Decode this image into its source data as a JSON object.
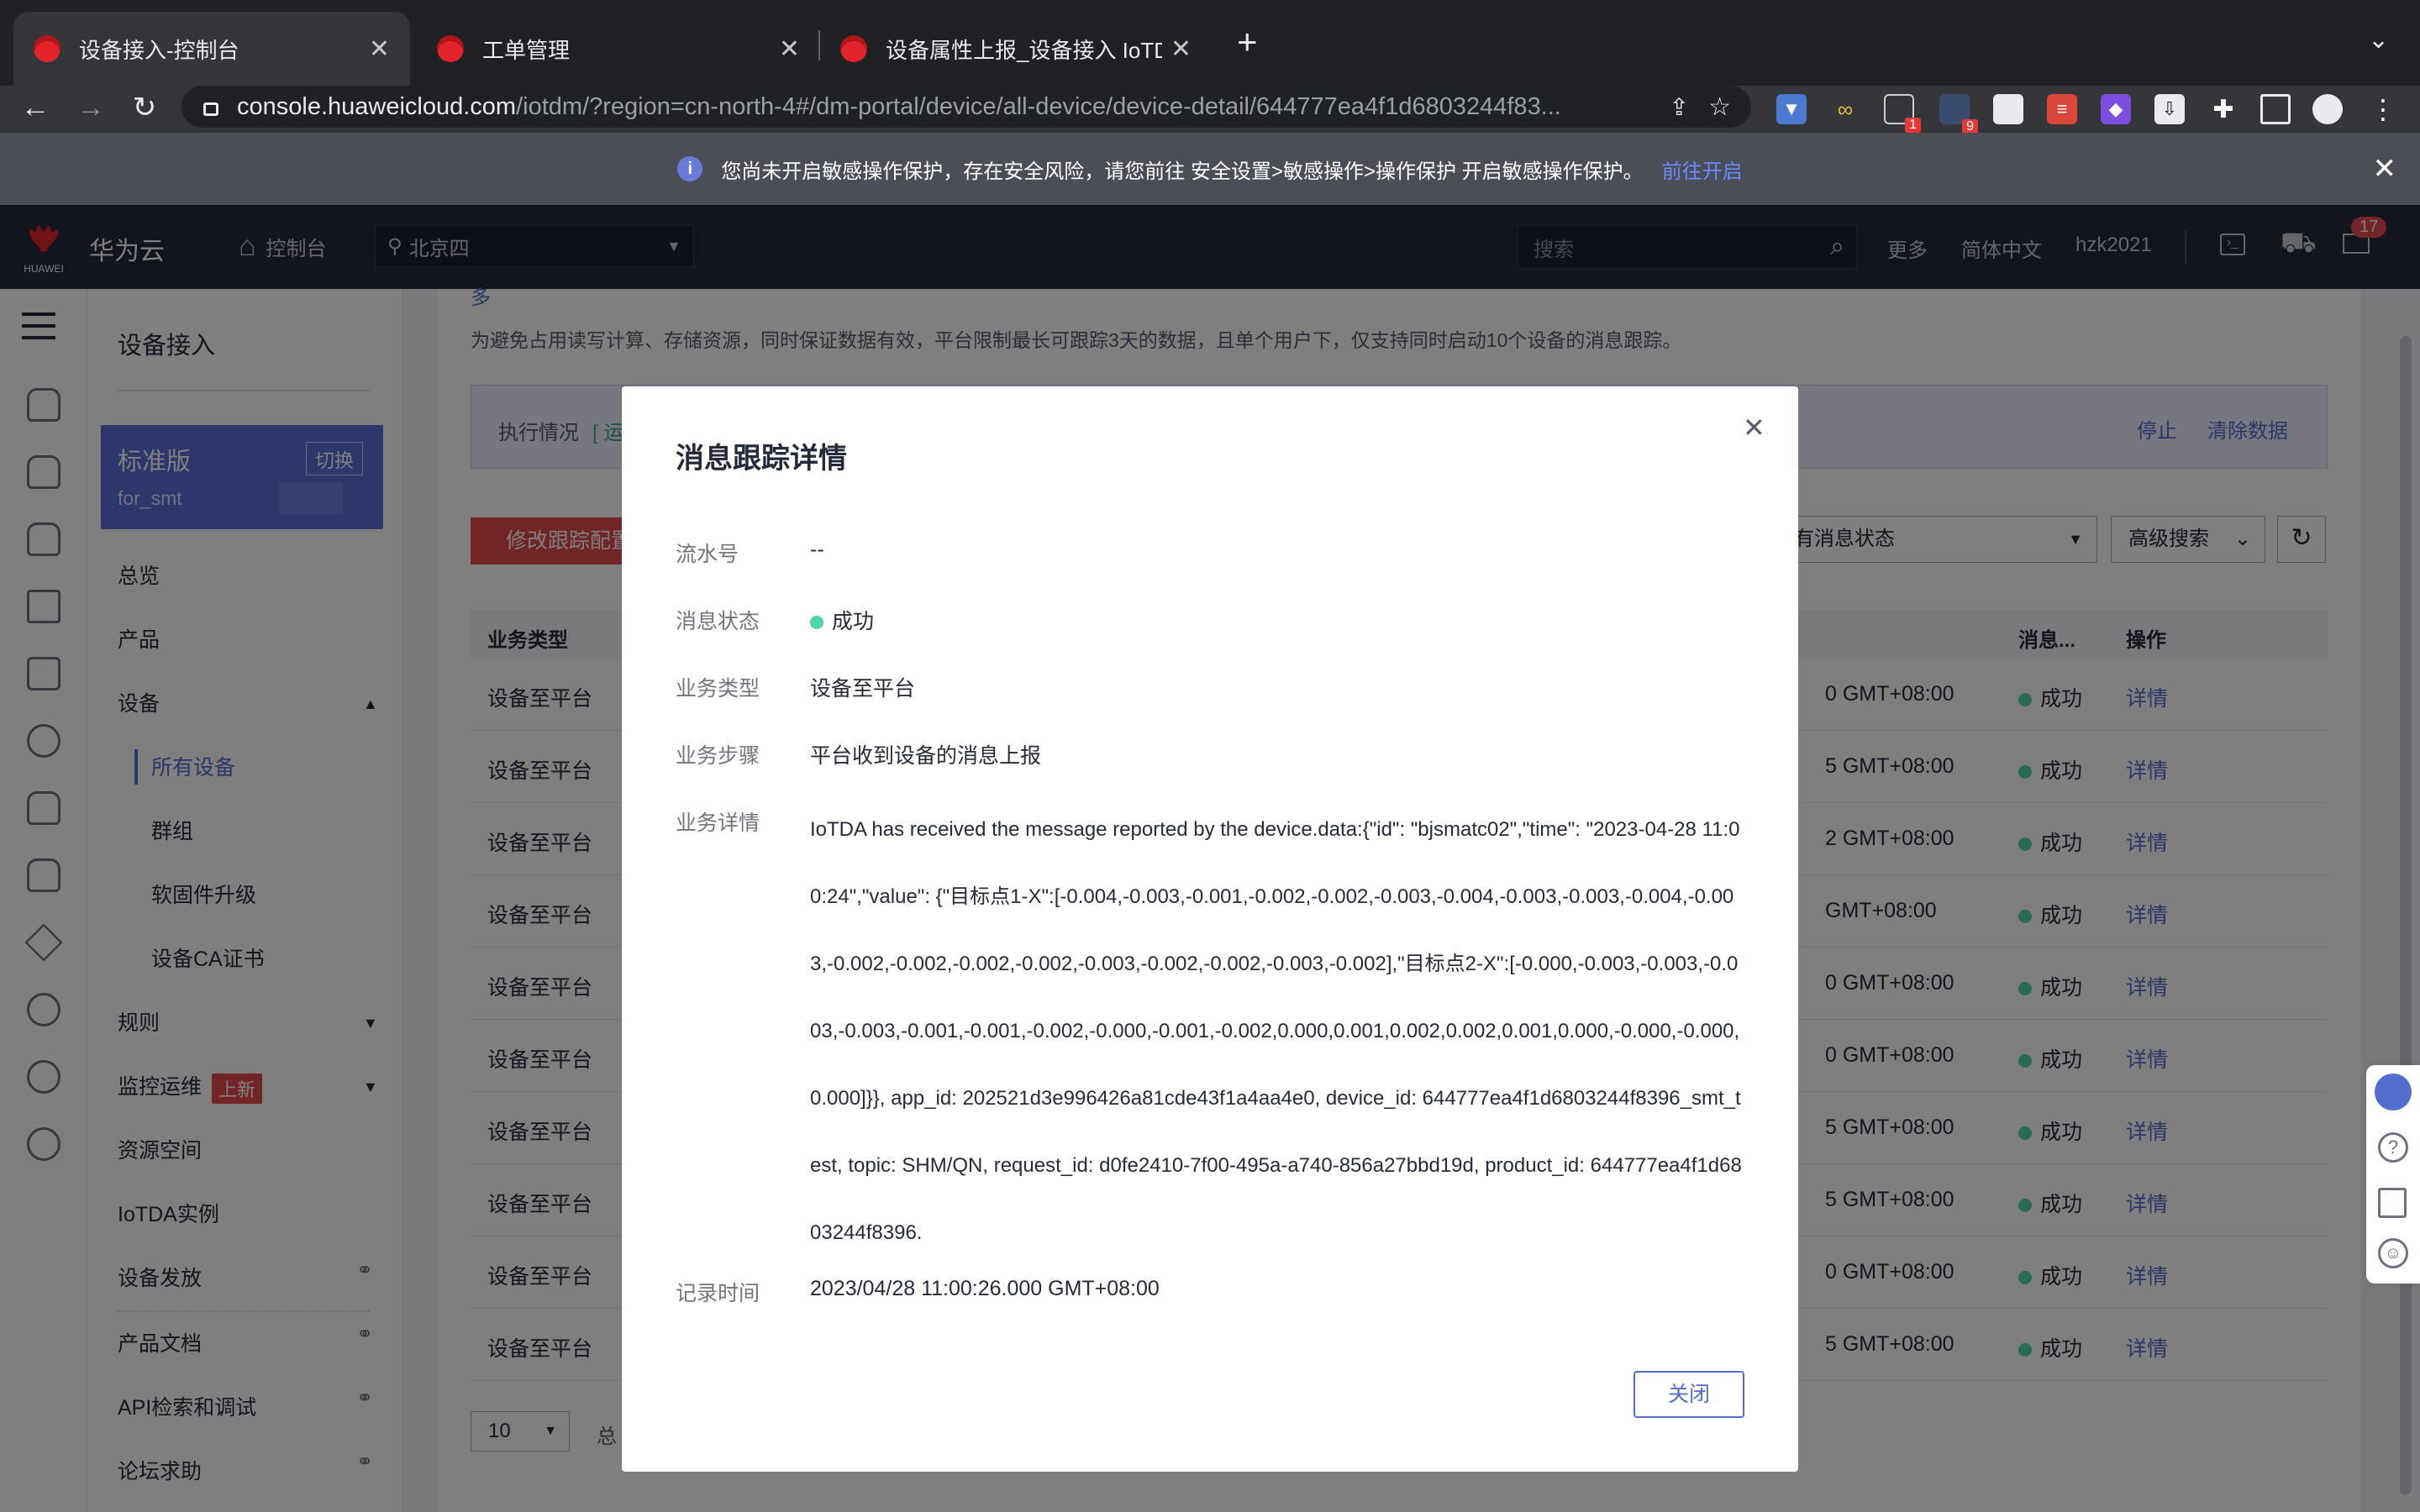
{
  "browser": {
    "tabs": [
      {
        "title": "设备接入-控制台",
        "active": true
      },
      {
        "title": "工单管理",
        "active": false
      },
      {
        "title": "设备属性上报_设备接入 IoTDA_",
        "active": false
      }
    ],
    "new_tab_icon": "plus-icon",
    "url_host": "console.huaweicloud.com",
    "url_path": "/iotdm/?region=cn-north-4#/dm-portal/device/all-device/device-detail/644777ea4f1d6803244f83...",
    "ext_badges": [
      "1",
      "9"
    ]
  },
  "banner": {
    "text": "您尚未开启敏感操作保护，存在安全风险，请您前往 安全设置>敏感操作>操作保护 开启敏感操作保护。",
    "link": "前往开启",
    "accent": "#526ecc"
  },
  "header": {
    "logo_text": "HUAWEI",
    "brand": "华为云",
    "console": "控制台",
    "region": "北京四",
    "search_placeholder": "搜索",
    "more": "更多",
    "language": "简体中文",
    "user": "hzk2021",
    "mail_badge": "17"
  },
  "sidebar": {
    "title": "设备接入",
    "edition": "标准版",
    "switch_label": "切换",
    "instance": "for_smt",
    "items": {
      "overview": "总览",
      "products": "产品",
      "devices": "设备",
      "all_devices": "所有设备",
      "groups": "群组",
      "firmware": "软固件升级",
      "ca": "设备CA证书",
      "rules": "规则",
      "monitor": "监控运维",
      "monitor_badge": "上新",
      "resource_space": "资源空间",
      "instances": "IoTDA实例",
      "provisioning": "设备发放",
      "docs": "产品文档",
      "api": "API检索和调试",
      "forum": "论坛求助"
    }
  },
  "main": {
    "top_fragment": "多",
    "notice": "为避免占用读写计算、存储资源，同时保证数据有效，平台限制最长可跟踪3天的数据，且单个用户下，仅支持同时启动10个设备的消息跟踪。",
    "exec_label": "执行情况",
    "exec_status": "[ 运",
    "stop": "停止",
    "clear": "清除数据",
    "modify_button": "修改跟踪配置",
    "status_filter": "有消息状态",
    "advanced_search": "高级搜索",
    "table": {
      "headers": {
        "type": "业务类型",
        "status": "消息...",
        "action": "操作"
      },
      "rows": [
        {
          "type": "设备至平台",
          "time_suffix": "0 GMT+08:00",
          "status": "成功",
          "action": "详情"
        },
        {
          "type": "设备至平台",
          "time_suffix": "5 GMT+08:00",
          "status": "成功",
          "action": "详情"
        },
        {
          "type": "设备至平台",
          "time_suffix": "2 GMT+08:00",
          "status": "成功",
          "action": "详情"
        },
        {
          "type": "设备至平台",
          "time_suffix": "GMT+08:00",
          "status": "成功",
          "action": "详情"
        },
        {
          "type": "设备至平台",
          "time_suffix": "0 GMT+08:00",
          "status": "成功",
          "action": "详情"
        },
        {
          "type": "设备至平台",
          "time_suffix": "0 GMT+08:00",
          "status": "成功",
          "action": "详情"
        },
        {
          "type": "设备至平台",
          "time_suffix": "5 GMT+08:00",
          "status": "成功",
          "action": "详情"
        },
        {
          "type": "设备至平台",
          "time_suffix": "5 GMT+08:00",
          "status": "成功",
          "action": "详情"
        },
        {
          "type": "设备至平台",
          "time_suffix": "0 GMT+08:00",
          "status": "成功",
          "action": "详情"
        },
        {
          "type": "设备至平台",
          "time_suffix": "5 GMT+08:00",
          "status": "成功",
          "action": "详情"
        }
      ]
    },
    "page_size": "10",
    "total_fragment": "总"
  },
  "modal": {
    "title": "消息跟踪详情",
    "fields": {
      "serial_label": "流水号",
      "serial_value": "--",
      "status_label": "消息状态",
      "status_value": "成功",
      "type_label": "业务类型",
      "type_value": "设备至平台",
      "step_label": "业务步骤",
      "step_value": "平台收到设备的消息上报",
      "detail_label": "业务详情",
      "detail_value": "IoTDA has received the message reported by the device.data:{\"id\": \"bjsmatc02\",\"time\": \"2023-04-28 11:00:24\",\"value\": {\"目标点1-X\":[-0.004,-0.003,-0.001,-0.002,-0.002,-0.003,-0.004,-0.003,-0.003,-0.004,-0.003,-0.002,-0.002,-0.002,-0.002,-0.003,-0.002,-0.002,-0.003,-0.002],\"目标点2-X\":[-0.000,-0.003,-0.003,-0.003,-0.003,-0.001,-0.001,-0.002,-0.000,-0.001,-0.002,0.000,0.001,0.002,0.002,0.001,0.000,-0.000,-0.000,0.000]}}, app_id: 202521d3e996426a81cde43f1a4aa4e0, device_id: 644777ea4f1d6803244f8396_smt_test, topic: SHM/QN, request_id: d0fe2410-7f00-495a-a740-856a27bbd19d, product_id: 644777ea4f1d6803244f8396.",
      "time_label": "记录时间",
      "time_value": "2023/04/28 11:00:26.000 GMT+08:00"
    },
    "close_button": "关闭",
    "close_icon": "close-icon"
  }
}
